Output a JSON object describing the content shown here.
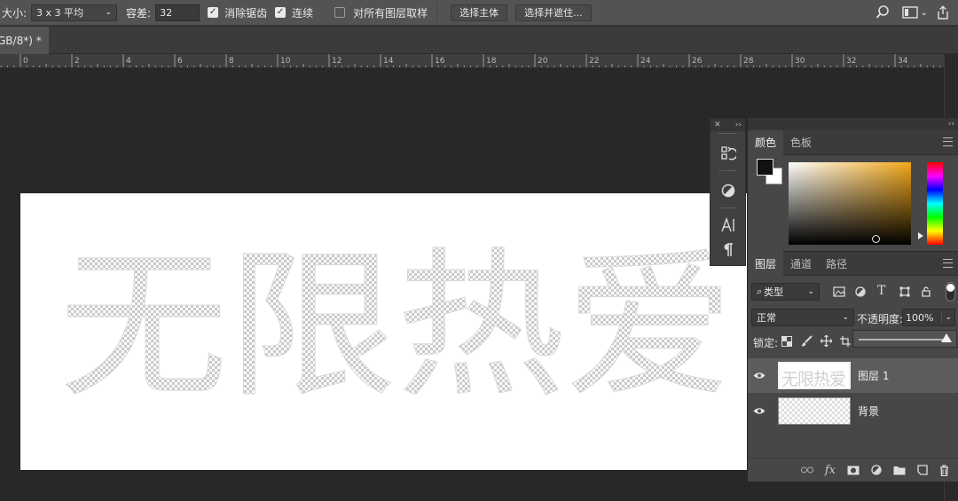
{
  "options_bar": {
    "size_label": "大小:",
    "size_value": "3 x 3 平均",
    "tolerance_label": "容差:",
    "tolerance_value": "32",
    "antialias_label": "消除锯齿",
    "contiguous_label": "连续",
    "sample_all_label": "对所有图层取样",
    "select_subject": "选择主体",
    "select_mask": "选择并遮住...",
    "checkbox_checked_glyph": "✓"
  },
  "document_tab": {
    "title": "GB/8*) *"
  },
  "ruler": {
    "labels": [
      "0",
      "2",
      "4",
      "6",
      "8",
      "10",
      "12",
      "14",
      "16",
      "18",
      "20",
      "22",
      "24",
      "26",
      "28",
      "30",
      "32",
      "34"
    ]
  },
  "canvas": {
    "text": "无限热爱"
  },
  "color_panel": {
    "tabs": [
      "颜色",
      "色板"
    ],
    "accent_color": "#f1a819"
  },
  "layers_panel": {
    "tabs": [
      "图层",
      "通道",
      "路径"
    ],
    "filter_label": "类型",
    "blend_mode": "正常",
    "opacity_label": "不透明度:",
    "opacity_value": "100%",
    "lock_label": "锁定:",
    "layers": [
      {
        "name": "图层 1",
        "selected": true,
        "thumb_text": "无限热爱"
      },
      {
        "name": "背景",
        "selected": false
      }
    ],
    "footer_icons": [
      "link-icon",
      "fx-icon",
      "mask-icon",
      "adjustment-icon",
      "folder-icon",
      "new-layer-icon",
      "trash-icon"
    ],
    "fx_label": "fx"
  }
}
